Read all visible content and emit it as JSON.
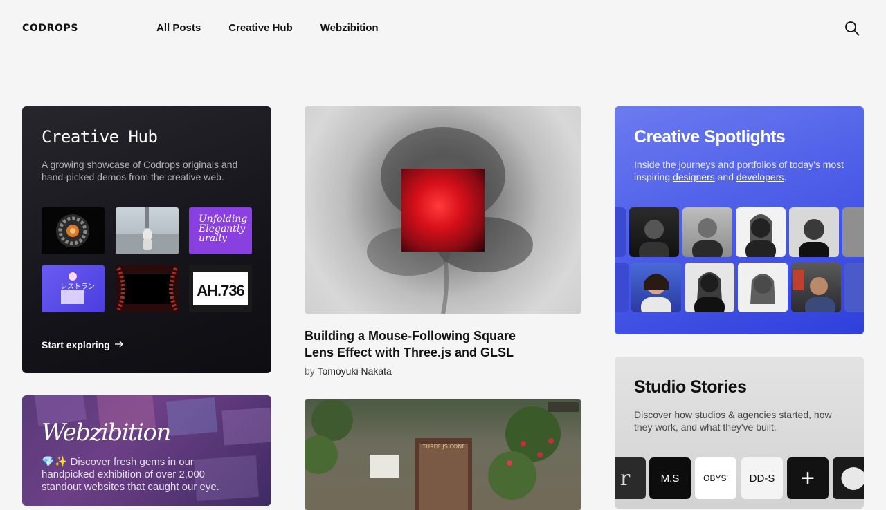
{
  "header": {
    "logo": "CODROPS",
    "nav": [
      {
        "label": "All Posts"
      },
      {
        "label": "Creative Hub"
      },
      {
        "label": "Webzibition"
      }
    ],
    "search_icon": "search-icon"
  },
  "hub": {
    "title": "Creative Hub",
    "description": "A growing showcase of Codrops originals and hand-picked demos from the creative web.",
    "thumbs": {
      "t3_text": "Unfolding Elegantly urally",
      "t4_text": "レストラン",
      "t6_text": "AH.736"
    },
    "cta": "Start exploring",
    "cta_icon": "arrow-right-icon"
  },
  "webzibition": {
    "title": "Webzibition",
    "description": "💎✨ Discover fresh gems in our handpicked exhibition of over 2,000 standout websites that caught our eye."
  },
  "feature": {
    "title": "Building a Mouse-Following Square Lens Effect with Three.js and GLSL",
    "by_prefix": "by",
    "author": "Tomoyuki Nakata"
  },
  "spotlights": {
    "title": "Creative Spotlights",
    "desc_1": "Inside the journeys and portfolios of today's most inspiring ",
    "link_designers": "designers",
    "desc_and": " and ",
    "link_developers": "developers",
    "desc_end": "."
  },
  "studio": {
    "title": "Studio Stories",
    "description": "Discover how studios & agencies started, how they work, and what they've built.",
    "logos": [
      "r",
      "M.S",
      "OBYS'",
      "DD-S",
      "+",
      ""
    ]
  },
  "colors": {
    "hub_bg": "#14141a",
    "spot_bg": "#4e5fe8",
    "web_bg": "#6c3f86",
    "page_bg": "#f5f5f5"
  }
}
